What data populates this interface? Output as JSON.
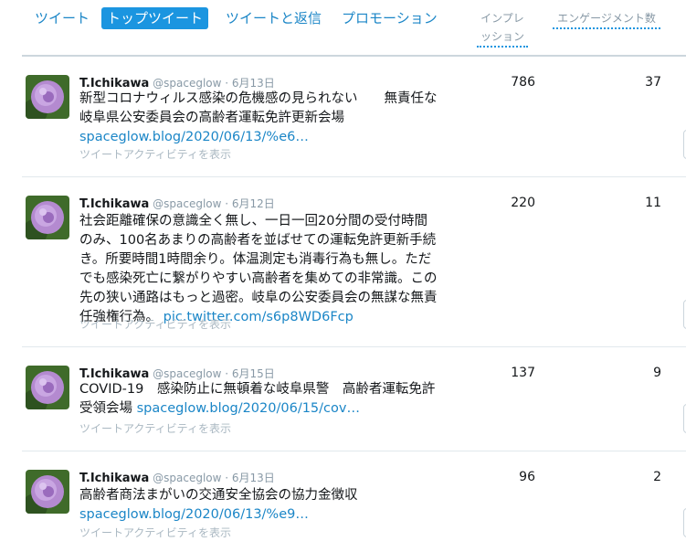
{
  "tabs": [
    {
      "label": "ツイート",
      "active": false
    },
    {
      "label": "トップツイート",
      "active": true
    },
    {
      "label": "ツイートと返信",
      "active": false
    },
    {
      "label": "プロモーション",
      "active": false
    }
  ],
  "columns": {
    "impressions_line1": "インプレ",
    "impressions_line2": "ッション",
    "engagements": "エンゲージメント数"
  },
  "tweets": [
    {
      "name": "T.Ichikawa",
      "handle": "@spaceglow",
      "date": "6月13日",
      "text": "新型コロナウィルス感染の危機感の見られない　　無責任な岐阜県公安委員会の高齢者運転免許更新会場",
      "link": "spaceglow.blog/2020/06/13/%e6…",
      "activity": "ツイートアクティビティを表示",
      "impressions": "786",
      "engagements": "37"
    },
    {
      "name": "T.Ichikawa",
      "handle": "@spaceglow",
      "date": "6月12日",
      "text": "社会距離確保の意識全く無し、一日一回20分間の受付時間のみ、100名あまりの高齢者を並ばせての運転免許更新手続き。所要時間1時間余り。体温測定も消毒行為も無し。ただでも感染死亡に繋がりやすい高齢者を集めての非常識。この先の狭い通路はもっと過密。岐阜の公安委員会の無謀な無責任強権行為。",
      "link": "pic.twitter.com/s6p8WD6Fcp",
      "activity": "ツイートアクティビティを表示",
      "impressions": "220",
      "engagements": "11"
    },
    {
      "name": "T.Ichikawa",
      "handle": "@spaceglow",
      "date": "6月15日",
      "text": "COVID-19　感染防止に無頓着な岐阜県警　高齢者運転免許受領会場",
      "link": "spaceglow.blog/2020/06/15/cov…",
      "activity": "ツイートアクティビティを表示",
      "impressions": "137",
      "engagements": "9"
    },
    {
      "name": "T.Ichikawa",
      "handle": "@spaceglow",
      "date": "6月13日",
      "text": "高齢者商法まがいの交通安全協会の協力金徴収",
      "link": "spaceglow.blog/2020/06/13/%e9…",
      "activity": "ツイートアクティビティを表示",
      "impressions": "96",
      "engagements": "2"
    }
  ]
}
